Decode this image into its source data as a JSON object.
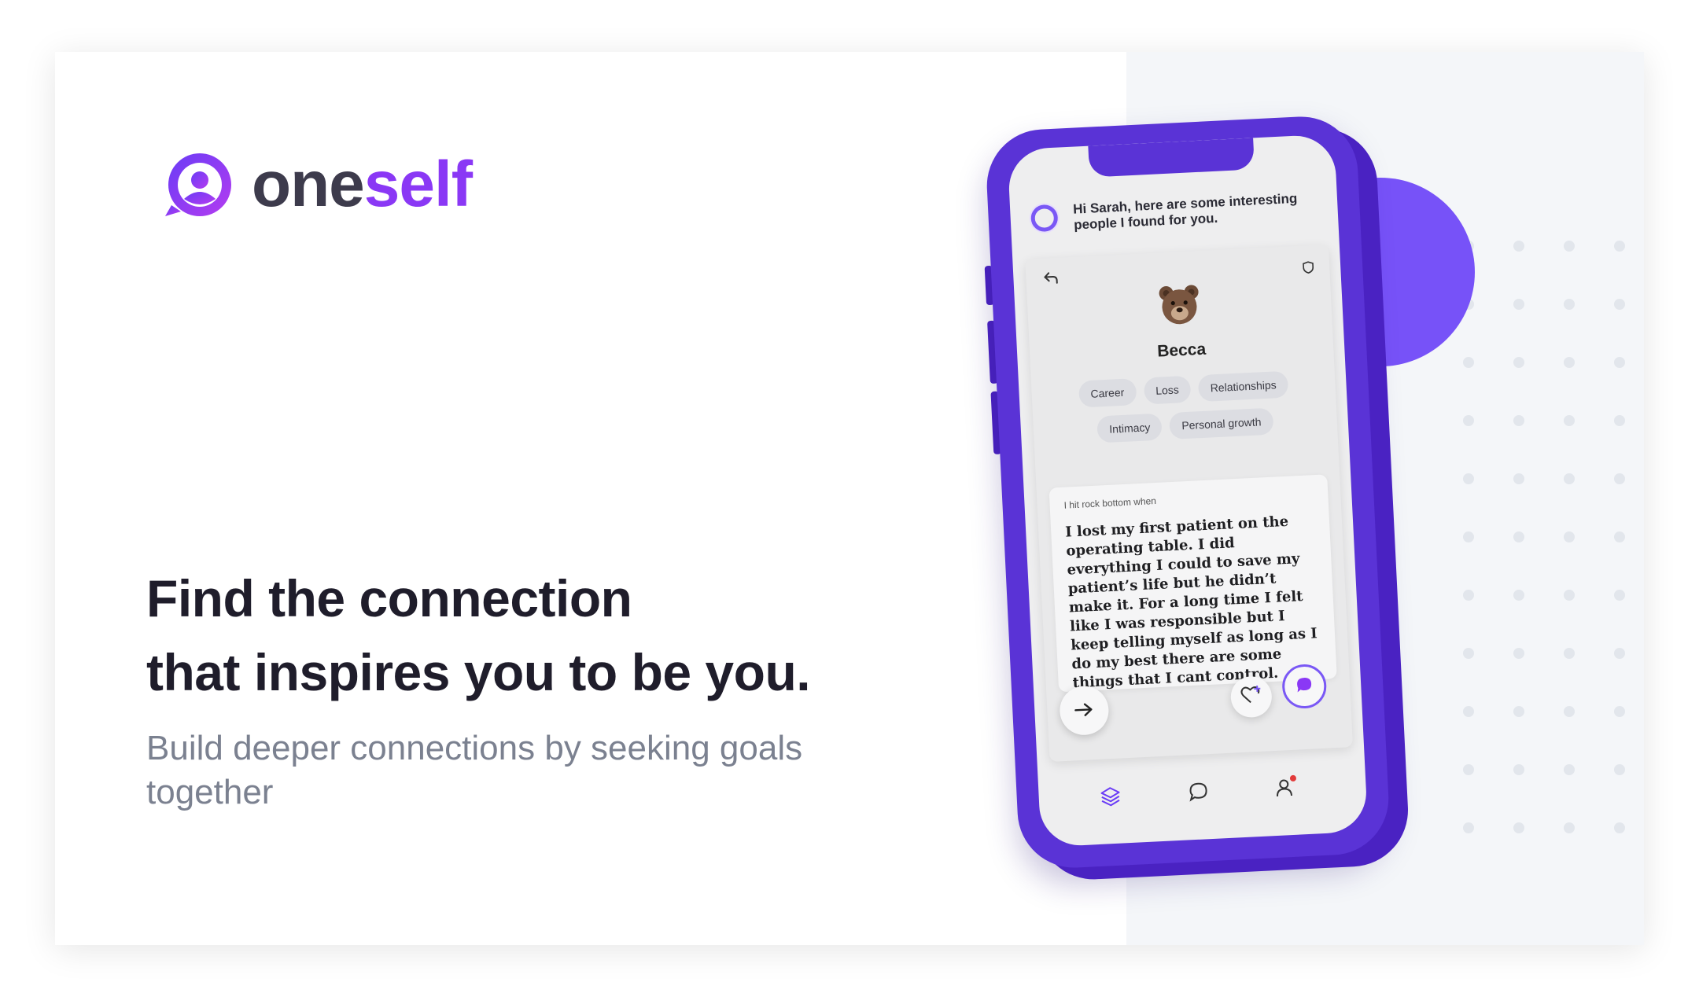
{
  "brand": {
    "name_part1": "one",
    "name_part2": "self",
    "primary_color": "#8a38f5",
    "phone_color": "#5a33d6",
    "accent_circle_color": "#7752f8"
  },
  "hero": {
    "headline_line1": "Find the connection",
    "headline_line2": "that inspires you to be you.",
    "subheadline": "Build deeper connections by seeking goals together"
  },
  "app": {
    "greeting": "Hi Sarah, here are some interesting people I found for you.",
    "profile": {
      "name": "Becca",
      "tags": [
        "Career",
        "Loss",
        "Relationships",
        "Intimacy",
        "Personal growth"
      ],
      "story_prompt": "I hit rock bottom when",
      "story_text": "I lost my first patient on the operating table. I did everything I could to save my patient’s life but he didn’t make it. For a long time I felt like I was responsible but I keep telling myself as long as I do my best there are some things that I cant control."
    },
    "icons": {
      "back": "back-arrow-icon",
      "shield": "shield-icon",
      "next": "arrow-right-icon",
      "like": "heart-plus-icon",
      "chat": "chat-bubble-icon",
      "tabs": [
        "layers-icon",
        "message-icon",
        "profile-icon"
      ]
    }
  }
}
